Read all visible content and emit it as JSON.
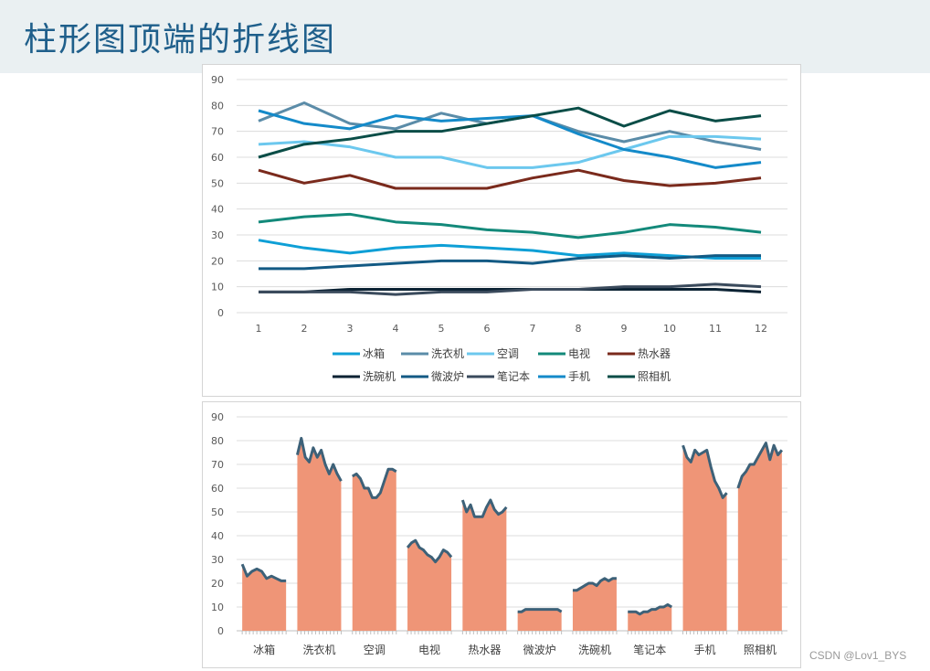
{
  "page": {
    "title": "柱形图顶端的折线图",
    "watermark": "CSDN @Lov1_BYS"
  },
  "chart_data": [
    {
      "type": "line",
      "x": [
        1,
        2,
        3,
        4,
        5,
        6,
        7,
        8,
        9,
        10,
        11,
        12
      ],
      "ylim": [
        0,
        90
      ],
      "yticks": [
        0,
        10,
        20,
        30,
        40,
        50,
        60,
        70,
        80,
        90
      ],
      "grid": true,
      "legend_position": "bottom",
      "series": [
        {
          "name": "冰箱",
          "color": "#0e9fd6",
          "values": [
            28,
            25,
            23,
            25,
            26,
            25,
            24,
            22,
            23,
            22,
            21,
            21
          ]
        },
        {
          "name": "洗衣机",
          "color": "#5b8ca8",
          "values": [
            74,
            81,
            73,
            71,
            77,
            73,
            76,
            70,
            66,
            70,
            66,
            63
          ]
        },
        {
          "name": "空调",
          "color": "#6cc8ee",
          "values": [
            65,
            66,
            64,
            60,
            60,
            56,
            56,
            58,
            63,
            68,
            68,
            67
          ]
        },
        {
          "name": "电视",
          "color": "#13897a",
          "values": [
            35,
            37,
            38,
            35,
            34,
            32,
            31,
            29,
            31,
            34,
            33,
            31
          ]
        },
        {
          "name": "热水器",
          "color": "#7a2a1c",
          "values": [
            55,
            50,
            53,
            48,
            48,
            48,
            52,
            55,
            51,
            49,
            50,
            52
          ]
        },
        {
          "name": "洗碗机",
          "color": "#0b2233",
          "values": [
            8,
            8,
            9,
            9,
            9,
            9,
            9,
            9,
            9,
            9,
            9,
            8
          ]
        },
        {
          "name": "微波炉",
          "color": "#135a84",
          "values": [
            17,
            17,
            18,
            19,
            20,
            20,
            19,
            21,
            22,
            21,
            22,
            22
          ]
        },
        {
          "name": "笔记本",
          "color": "#3a4a5c",
          "values": [
            8,
            8,
            8,
            7,
            8,
            8,
            9,
            9,
            10,
            10,
            11,
            10
          ]
        },
        {
          "name": "手机",
          "color": "#148ac9",
          "values": [
            78,
            73,
            71,
            76,
            74,
            75,
            76,
            69,
            63,
            60,
            56,
            58
          ]
        },
        {
          "name": "照相机",
          "color": "#0a4d47",
          "values": [
            60,
            65,
            67,
            70,
            70,
            73,
            76,
            79,
            72,
            78,
            74,
            76
          ]
        }
      ]
    },
    {
      "type": "bar",
      "categories": [
        "冰箱",
        "洗衣机",
        "空调",
        "电视",
        "热水器",
        "微波炉",
        "洗碗机",
        "笔记本",
        "手机",
        "照相机"
      ],
      "values": [
        21,
        63,
        67,
        31,
        52,
        8,
        22,
        10,
        57,
        76
      ],
      "bar_color": "#ef9577",
      "line_color": "#3d6178",
      "overlay_lines": [
        [
          28,
          23,
          25,
          26,
          25,
          22,
          23,
          22,
          21,
          21
        ],
        [
          74,
          81,
          73,
          71,
          77,
          73,
          76,
          70,
          66,
          70,
          66,
          63
        ],
        [
          65,
          66,
          64,
          60,
          60,
          56,
          56,
          58,
          63,
          68,
          68,
          67
        ],
        [
          35,
          37,
          38,
          35,
          34,
          32,
          31,
          29,
          31,
          34,
          33,
          31
        ],
        [
          55,
          50,
          53,
          48,
          48,
          48,
          52,
          55,
          51,
          49,
          50,
          52
        ],
        [
          8,
          8,
          9,
          9,
          9,
          9,
          9,
          9,
          9,
          9,
          9,
          8
        ],
        [
          17,
          17,
          18,
          19,
          20,
          20,
          19,
          21,
          22,
          21,
          22,
          22
        ],
        [
          8,
          8,
          8,
          7,
          8,
          8,
          9,
          9,
          10,
          10,
          11,
          10
        ],
        [
          78,
          73,
          71,
          76,
          74,
          75,
          76,
          69,
          63,
          60,
          56,
          58
        ],
        [
          60,
          65,
          67,
          70,
          70,
          73,
          76,
          79,
          72,
          78,
          74,
          76
        ]
      ],
      "ylim": [
        0,
        90
      ],
      "yticks": [
        0,
        10,
        20,
        30,
        40,
        50,
        60,
        70,
        80,
        90
      ],
      "grid": true
    }
  ]
}
